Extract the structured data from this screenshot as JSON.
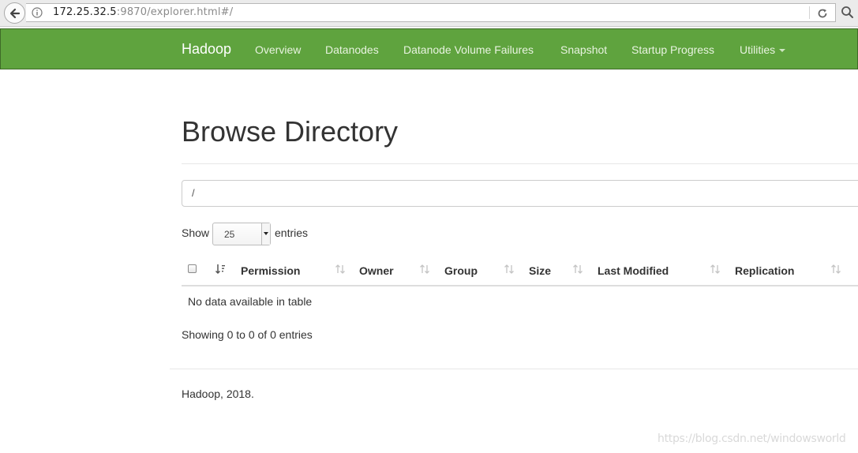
{
  "browser": {
    "url_host": "172.25.32.5",
    "url_rest": ":9870/explorer.html#/"
  },
  "navbar": {
    "brand": "Hadoop",
    "items": [
      {
        "label": "Overview"
      },
      {
        "label": "Datanodes"
      },
      {
        "label": "Datanode Volume Failures"
      },
      {
        "label": "Snapshot"
      },
      {
        "label": "Startup Progress"
      },
      {
        "label": "Utilities"
      }
    ]
  },
  "main": {
    "title": "Browse Directory",
    "directory_value": "/",
    "show_label": "Show",
    "entries_value": "25",
    "entries_label": "entries",
    "columns": [
      "Permission",
      "Owner",
      "Group",
      "Size",
      "Last Modified",
      "Replication"
    ],
    "empty_message": "No data available in table",
    "info": "Showing 0 to 0 of 0 entries"
  },
  "footer": {
    "text": "Hadoop, 2018."
  },
  "watermark": "https://blog.csdn.net/windowsworld",
  "colors": {
    "navbar_bg": "#5fa33e",
    "navbar_border": "#3e6b27"
  },
  "icons": [
    "back-arrow-icon",
    "info-icon",
    "reload-icon",
    "search-icon",
    "sort-icon",
    "caret-down-icon"
  ]
}
